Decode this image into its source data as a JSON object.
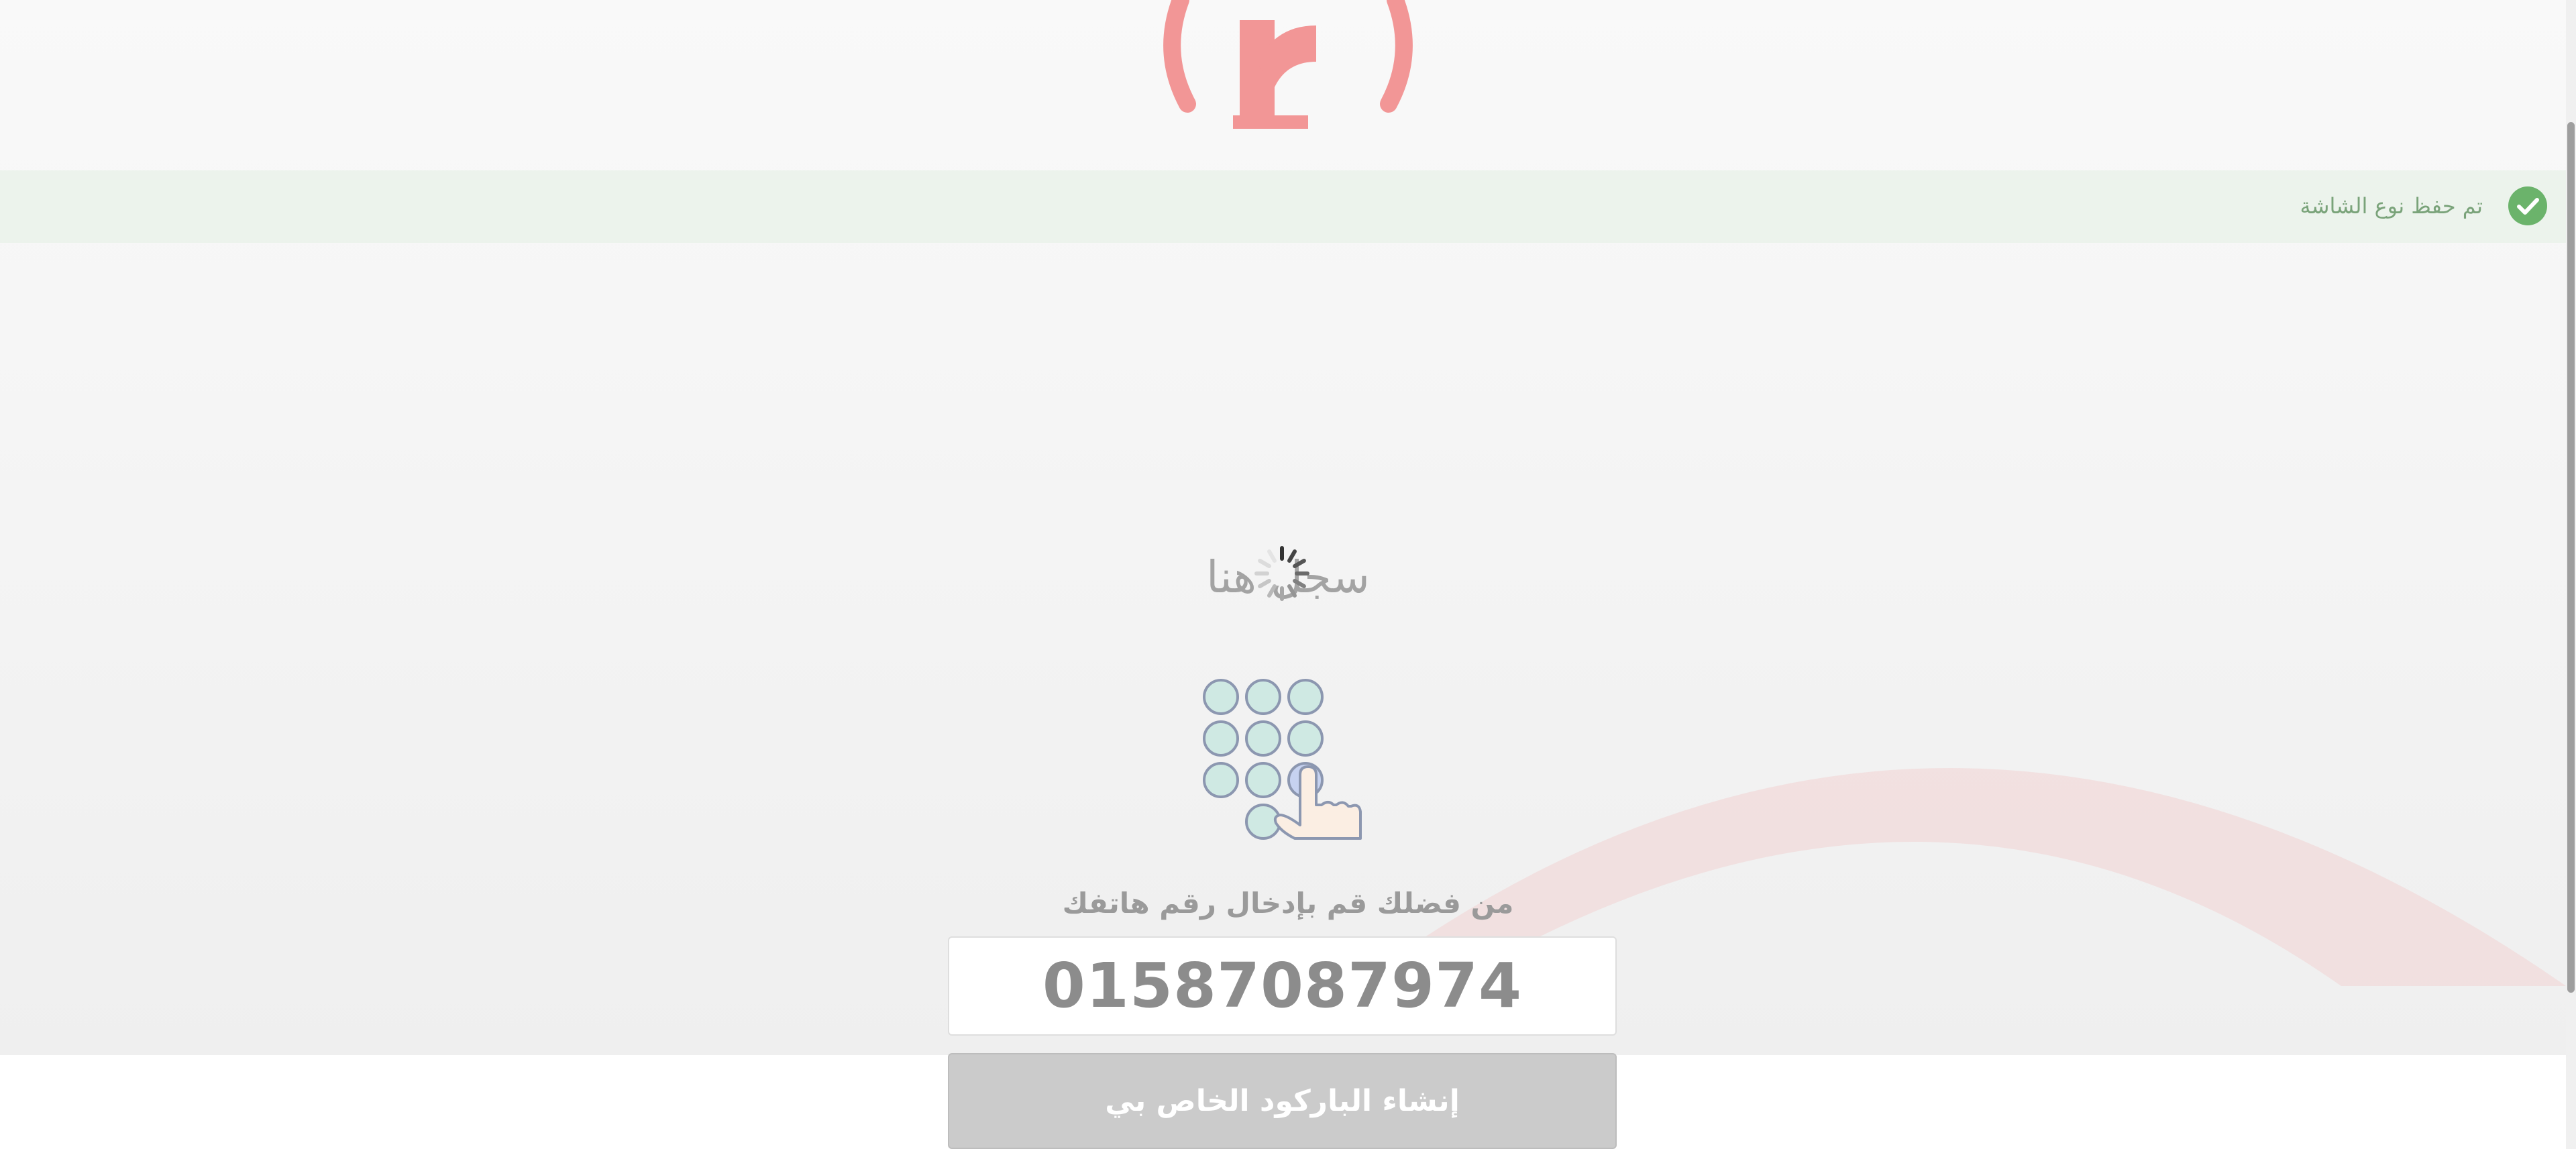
{
  "toast": {
    "message": "تم حفظ نوع الشاشة",
    "icon": "check-circle-icon",
    "icon_color": "#6bb36b"
  },
  "logo": {
    "icon": "brand-logo-icon",
    "color": "#f29696"
  },
  "register": {
    "title": "سجل هنا",
    "loading_icon": "spinner-icon",
    "keypad_icon": "keypad-hand-icon",
    "prompt": "من فضلك قم بإدخال رقم هاتفك",
    "phone_value": "01587087974",
    "button_label": "إنشاء الباركود الخاص بي"
  },
  "colors": {
    "accent": "#f29696",
    "button_disabled": "#cbcbcb",
    "success": "#6bb36b"
  }
}
